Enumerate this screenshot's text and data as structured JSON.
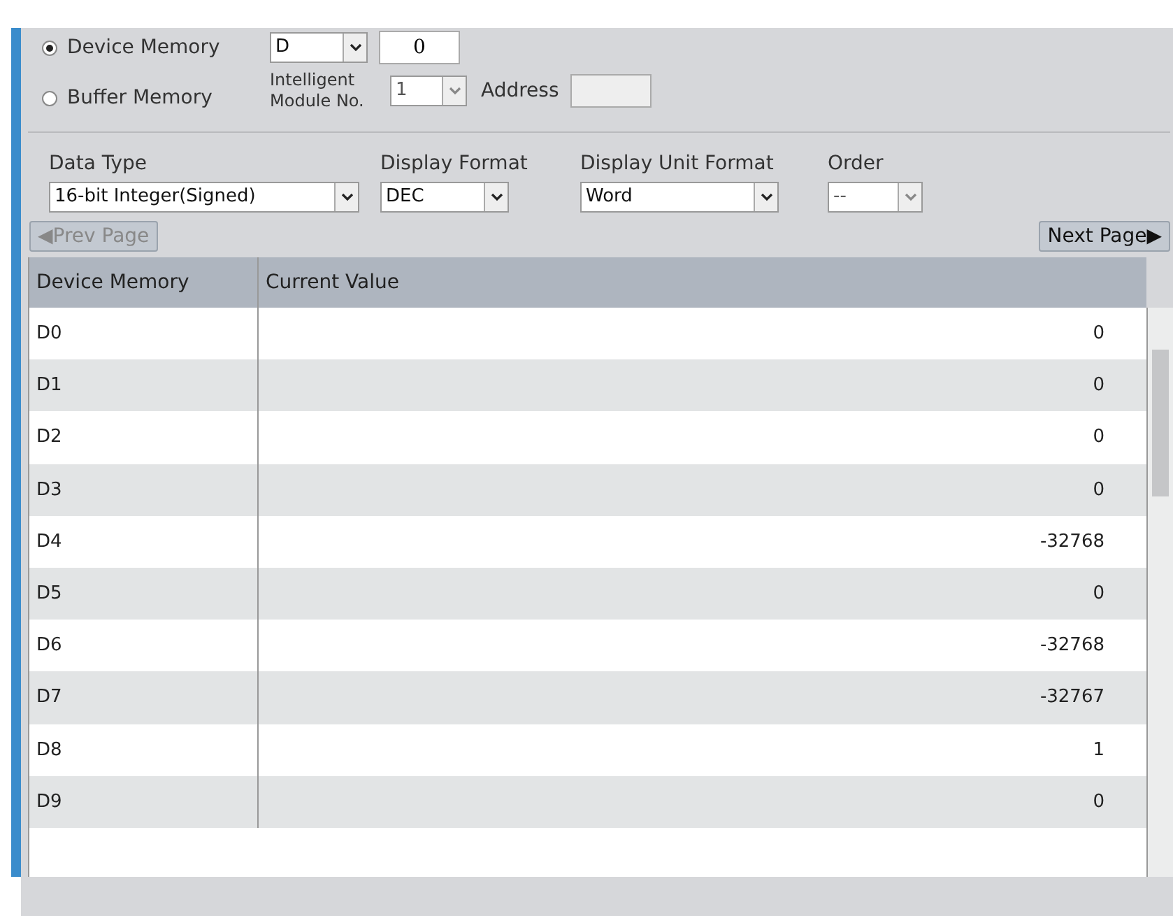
{
  "memory_type": [
    {
      "label": "Device Memory",
      "selected": true
    },
    {
      "label": "Buffer Memory",
      "selected": false
    }
  ],
  "device": {
    "value": "D",
    "number": "0"
  },
  "buffer": {
    "module_label": "Intelligent Module No.",
    "module_value": "1",
    "module_disabled": true,
    "address_label": "Address",
    "address_disabled": true
  },
  "settings": [
    {
      "label": "Data Type",
      "value": "16-bit Integer(Signed)",
      "disabled": false
    },
    {
      "label": "Display Format",
      "value": "DEC",
      "disabled": false
    },
    {
      "label": "Display Unit Format",
      "value": "Word",
      "disabled": false
    },
    {
      "label": "Order",
      "value": "--",
      "disabled": true
    }
  ],
  "prev_button": {
    "label": "◀Prev Page",
    "disabled": true
  },
  "next_button": {
    "label": "Next Page▶",
    "disabled": false
  },
  "table": {
    "columns": [
      "Device Memory",
      "Current Value"
    ],
    "rows": [
      [
        "D0",
        "0"
      ],
      [
        "D1",
        "0"
      ],
      [
        "D2",
        "0"
      ],
      [
        "D3",
        "0"
      ],
      [
        "D4",
        "-32768"
      ],
      [
        "D5",
        "0"
      ],
      [
        "D6",
        "-32768"
      ],
      [
        "D7",
        "-32767"
      ],
      [
        "D8",
        "1"
      ],
      [
        "D9",
        "0"
      ]
    ]
  }
}
